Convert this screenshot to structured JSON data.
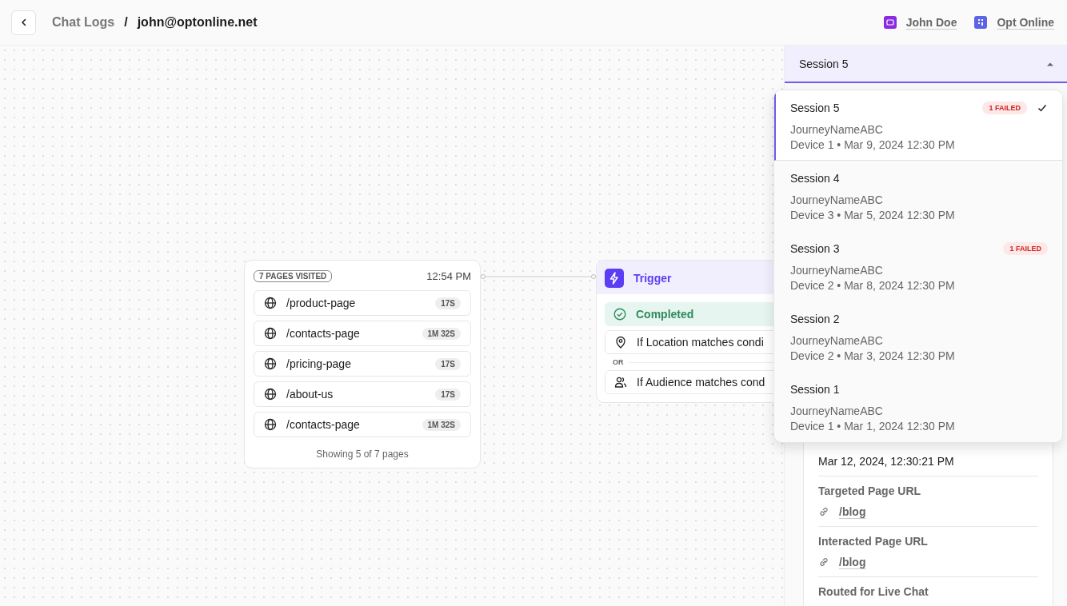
{
  "header": {
    "breadcrumb": [
      {
        "label": "Chat Logs"
      },
      {
        "label": "john@optonline.net"
      }
    ],
    "separator": "/",
    "links": [
      {
        "label": "John Doe",
        "color": "#8a2be2"
      },
      {
        "label": "Opt Online",
        "color": "#5b63e6"
      }
    ]
  },
  "pages_card": {
    "badge": "7 PAGES VISITED",
    "time": "12:54 PM",
    "pages": [
      {
        "path": "/product-page",
        "duration": "17S"
      },
      {
        "path": "/contacts-page",
        "duration": "1M 32S"
      },
      {
        "path": "/pricing-page",
        "duration": "17S"
      },
      {
        "path": "/about-us",
        "duration": "17S"
      },
      {
        "path": "/contacts-page",
        "duration": "1M 32S"
      }
    ],
    "footer": "Showing 5 of 7 pages"
  },
  "trigger_card": {
    "title": "Trigger",
    "status": "Completed",
    "separator": "OR",
    "conditions": [
      {
        "kind": "location",
        "text": "If Location matches condi"
      },
      {
        "kind": "audience",
        "text": "If Audience matches cond"
      }
    ]
  },
  "session_select": {
    "value": "Session 5",
    "expanded": true,
    "options": [
      {
        "title": "Session 5",
        "badge": "1 FAILED",
        "journey": "JourneyNameABC",
        "meta": "Device 1 • Mar 9, 2024 12:30 PM",
        "selected": true
      },
      {
        "title": "Session 4",
        "journey": "JourneyNameABC",
        "meta": "Device 3 • Mar 5, 2024 12:30 PM",
        "selected": false
      },
      {
        "title": "Session 3",
        "badge": "1 FAILED",
        "journey": "JourneyNameABC",
        "meta": "Device 2 • Mar 8, 2024 12:30 PM",
        "selected": false
      },
      {
        "title": "Session 2",
        "journey": "JourneyNameABC",
        "meta": "Device 2 • Mar 3, 2024 12:30 PM",
        "selected": false
      },
      {
        "title": "Session 1",
        "journey": "JourneyNameABC",
        "meta": "Device 1 • Mar 1, 2024 12:30 PM",
        "selected": false
      }
    ]
  },
  "details": {
    "fields": [
      {
        "kind": "text",
        "value": "Mar 12, 2024, 12:30:21 PM"
      },
      {
        "kind": "link",
        "label": "Targeted Page URL",
        "value": "/blog"
      },
      {
        "kind": "link",
        "label": "Interacted Page URL",
        "value": "/blog"
      },
      {
        "label": "Routed for Live Chat"
      }
    ]
  }
}
